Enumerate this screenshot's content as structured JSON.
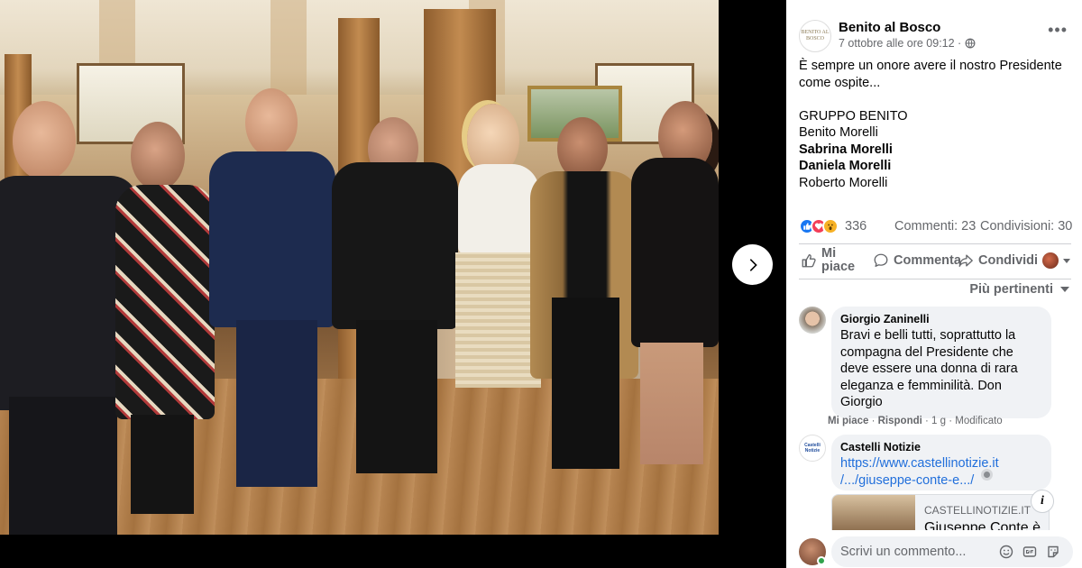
{
  "viewer": {
    "next_button_label": "Next photo"
  },
  "post": {
    "page_name": "Benito al Bosco",
    "page_logo_text": "BENITO AL BOSCO",
    "timestamp": "7 ottobre alle ore 09:12 ·",
    "text_lines": [
      "È sempre un onore avere il nostro Presidente",
      "come ospite..."
    ],
    "group_title": "GRUPPO BENITO",
    "members": [
      {
        "name": "Benito Morelli",
        "bold": false
      },
      {
        "name": "Sabrina Morelli",
        "bold": true
      },
      {
        "name": "Daniela Morelli",
        "bold": true
      },
      {
        "name": "Roberto Morelli",
        "bold": false
      }
    ],
    "reaction_count": "336",
    "comments_count": "Commenti: 23",
    "shares_count": "Condivisioni: 30",
    "reactions": [
      "like-icon",
      "love-icon",
      "wow-icon"
    ]
  },
  "actions": {
    "like_line1": "Mi",
    "like_line2": "piace",
    "comment": "Commenta",
    "share": "Condividi"
  },
  "sort_label": "Più pertinenti",
  "comments": [
    {
      "author": "Giorgio Zaninelli",
      "lines": [
        "Bravi e belli tutti, soprattutto la",
        "compagna del Presidente che",
        "deve essere una donna di rara",
        "eleganza e femminilità. Don",
        "Giorgio"
      ],
      "like": "Mi piace",
      "reply": "Rispondi",
      "meta": "· 1 g · Modificato"
    },
    {
      "author": "Castelli Notizie",
      "avatar_text": "Castelli Notizie",
      "link_lines": [
        "https://www.castellinotizie.it",
        "/.../giuseppe-conte-e.../"
      ],
      "preview_domain": "CASTELLINOTIZIE.IT",
      "preview_title": "Giuseppe Conte è"
    }
  ],
  "composer": {
    "placeholder": "Scrivi un commento..."
  },
  "colors": {
    "link": "#216fdb",
    "secondary_text": "#65676b",
    "bubble": "#f0f2f5",
    "like_blue": "#1877f2",
    "love_red": "#f33e58",
    "wow_yellow": "#f7b125",
    "online_green": "#31a24c"
  }
}
